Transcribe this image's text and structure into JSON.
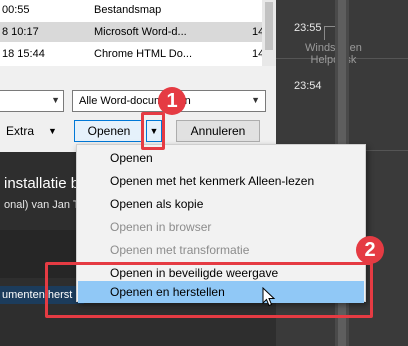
{
  "dialog": {
    "files": [
      {
        "date": "00:55",
        "type": "Bestandsmap",
        "size": ""
      },
      {
        "date": "8 10:17",
        "type": "Microsoft Word-d...",
        "size": "14"
      },
      {
        "date": "18 15:44",
        "type": "Chrome HTML Do...",
        "size": "14"
      }
    ],
    "filter_value": "Alle Word-documenten",
    "extra_label": "Extra",
    "open_label": "Openen",
    "cancel_label": "Annuleren"
  },
  "menu": {
    "items": [
      {
        "label": "Openen",
        "enabled": true
      },
      {
        "label": "Openen met het kenmerk Alleen-lezen",
        "enabled": true
      },
      {
        "label": "Openen als kopie",
        "enabled": true
      },
      {
        "label": "Openen in browser",
        "enabled": false
      },
      {
        "label": "Openen met transformatie",
        "enabled": false
      },
      {
        "label": "Openen in beveiligde weergave",
        "enabled": true
      },
      {
        "label": "Openen en herstellen",
        "enabled": true,
        "highlighted": true
      }
    ]
  },
  "background": {
    "times": [
      "23:55",
      "23:54"
    ],
    "watermark": [
      "Windstellen",
      "Helpdesk"
    ],
    "article_title": "installatie b",
    "article_subtitle": "onal) van Jan T",
    "strip_text": "umenten herst"
  },
  "callouts": {
    "badge_1": "1",
    "badge_2": "2",
    "color": "#e53b43"
  },
  "colors": {
    "accent": "#0078d7",
    "highlight": "#90c8f6"
  }
}
